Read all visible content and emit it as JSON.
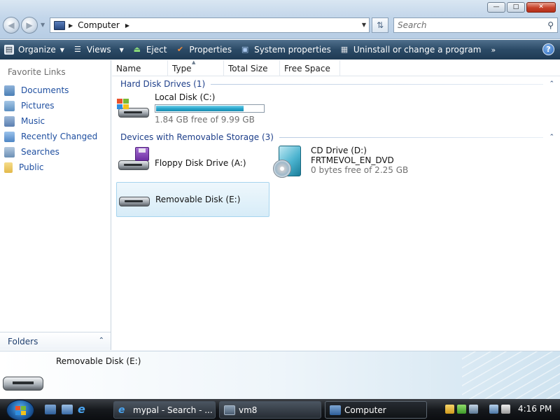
{
  "window": {
    "controls": [
      "minimize",
      "maximize",
      "close"
    ]
  },
  "address_bar": {
    "crumb": "Computer",
    "search_placeholder": "Search"
  },
  "toolbar": {
    "organize": "Organize",
    "views": "Views",
    "eject": "Eject",
    "properties": "Properties",
    "system_properties": "System properties",
    "uninstall": "Uninstall or change a program",
    "more": "»"
  },
  "nav_pane": {
    "title": "Favorite Links",
    "items": [
      {
        "label": "Documents",
        "icon": "documents-icon",
        "color": "#4b7fb5"
      },
      {
        "label": "Pictures",
        "icon": "pictures-icon",
        "color": "#5c8fc1"
      },
      {
        "label": "Music",
        "icon": "music-icon",
        "color": "#5b7fb0"
      },
      {
        "label": "Recently Changed",
        "icon": "recent-icon",
        "color": "#4e86c4"
      },
      {
        "label": "Searches",
        "icon": "searches-icon",
        "color": "#6b8fb5"
      },
      {
        "label": "Public",
        "icon": "folder-icon",
        "color": "#e3b94a"
      }
    ],
    "folders_label": "Folders"
  },
  "columns": [
    "Name",
    "Type",
    "Total Size",
    "Free Space"
  ],
  "groups": {
    "hard_disks": "Hard Disk Drives (1)",
    "removable": "Devices with Removable Storage (3)"
  },
  "drives": {
    "local": {
      "name": "Local Disk (C:)",
      "free": "1.84 GB free of 9.99 GB",
      "used_fraction": 0.82
    },
    "floppy": {
      "name": "Floppy Disk Drive (A:)"
    },
    "cd": {
      "name": "CD Drive (D:)",
      "label": "FRTMEVOL_EN_DVD",
      "free": "0 bytes free of 2.25 GB"
    },
    "removable": {
      "name": "Removable Disk (E:)"
    }
  },
  "details": {
    "name": "Removable Disk (E:)"
  },
  "taskbar": {
    "tasks": [
      {
        "label": "mypal - Search - ...",
        "icon": "ie-icon"
      },
      {
        "label": "vm8",
        "icon": "vm-icon"
      },
      {
        "label": "Computer",
        "icon": "computer-icon",
        "active": true
      }
    ],
    "clock": "4:16 PM"
  },
  "colors": {
    "link": "#1f4fa0",
    "group_header": "#1e3f8a",
    "progress_fill": "#26a3c9",
    "command_bar": "#2b4a66"
  }
}
